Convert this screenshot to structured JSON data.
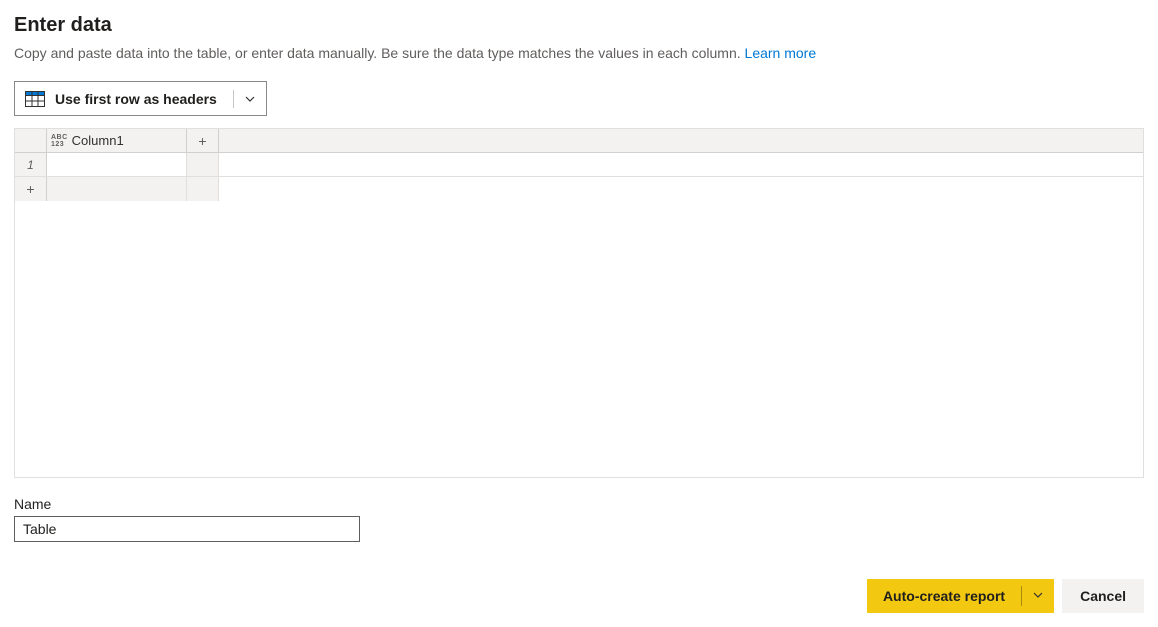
{
  "header": {
    "title": "Enter data",
    "description": "Copy and paste data into the table, or enter data manually. Be sure the data type matches the values in each column.",
    "learn_more_label": "Learn more"
  },
  "toolbar": {
    "use_first_row_label": "Use first row as headers"
  },
  "grid": {
    "columns": [
      {
        "name": "Column1",
        "type_label_top": "ABC",
        "type_label_bottom": "123"
      }
    ],
    "rows": [
      {
        "number": "1",
        "cells": [
          ""
        ]
      }
    ],
    "add_column_symbol": "+",
    "add_row_symbol": "+"
  },
  "name_field": {
    "label": "Name",
    "value": "Table"
  },
  "footer": {
    "primary_label": "Auto-create report",
    "cancel_label": "Cancel"
  }
}
